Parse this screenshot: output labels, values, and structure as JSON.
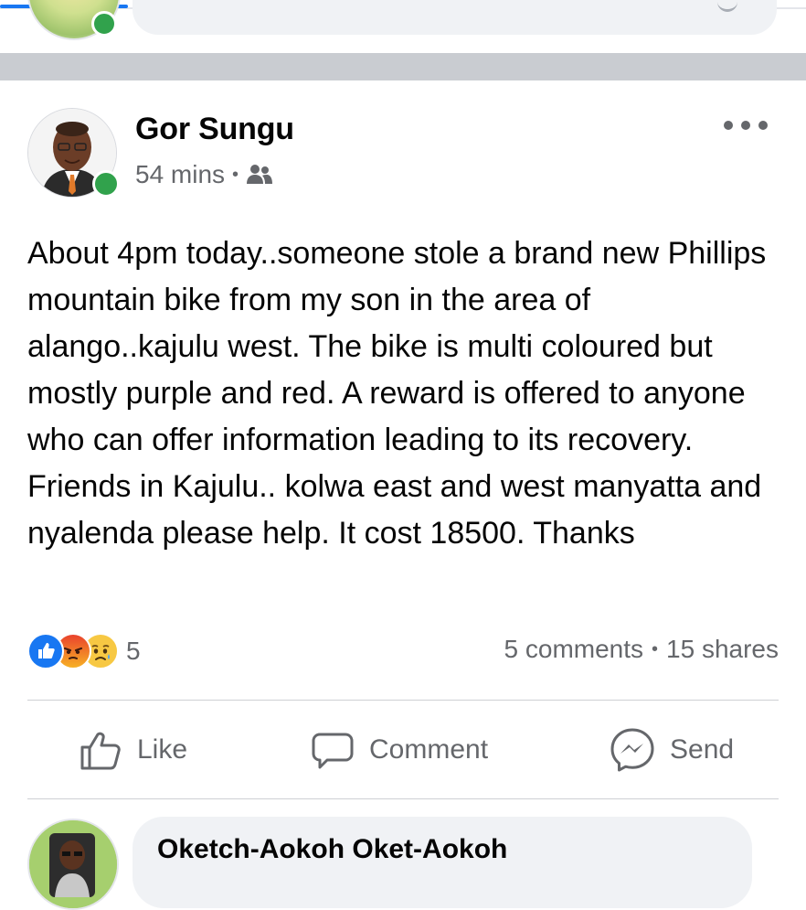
{
  "post": {
    "author": "Gor Sungu",
    "time": "54 mins",
    "separator": "•",
    "privacy_icon": "friends-icon",
    "text": "About 4pm today..someone stole a brand new Phillips mountain bike from my son in the area of alango..kajulu west. The bike is multi coloured but mostly purple and red. A reward is offered to anyone who can offer information leading to its recovery. Friends in Kajulu.. kolwa east and west manyatta and nyalenda please help. It cost 18500. Thanks",
    "reaction_count": "5",
    "comments": "5 comments",
    "shares": "15 shares"
  },
  "actions": {
    "like": "Like",
    "comment": "Comment",
    "send": "Send"
  },
  "comment_preview": {
    "author": "Oketch-Aokoh Oket-Aokoh"
  },
  "colors": {
    "accent": "#1877f2",
    "online": "#31a24c",
    "secondary_text": "#65676b",
    "separator": "#c9ccd1"
  }
}
